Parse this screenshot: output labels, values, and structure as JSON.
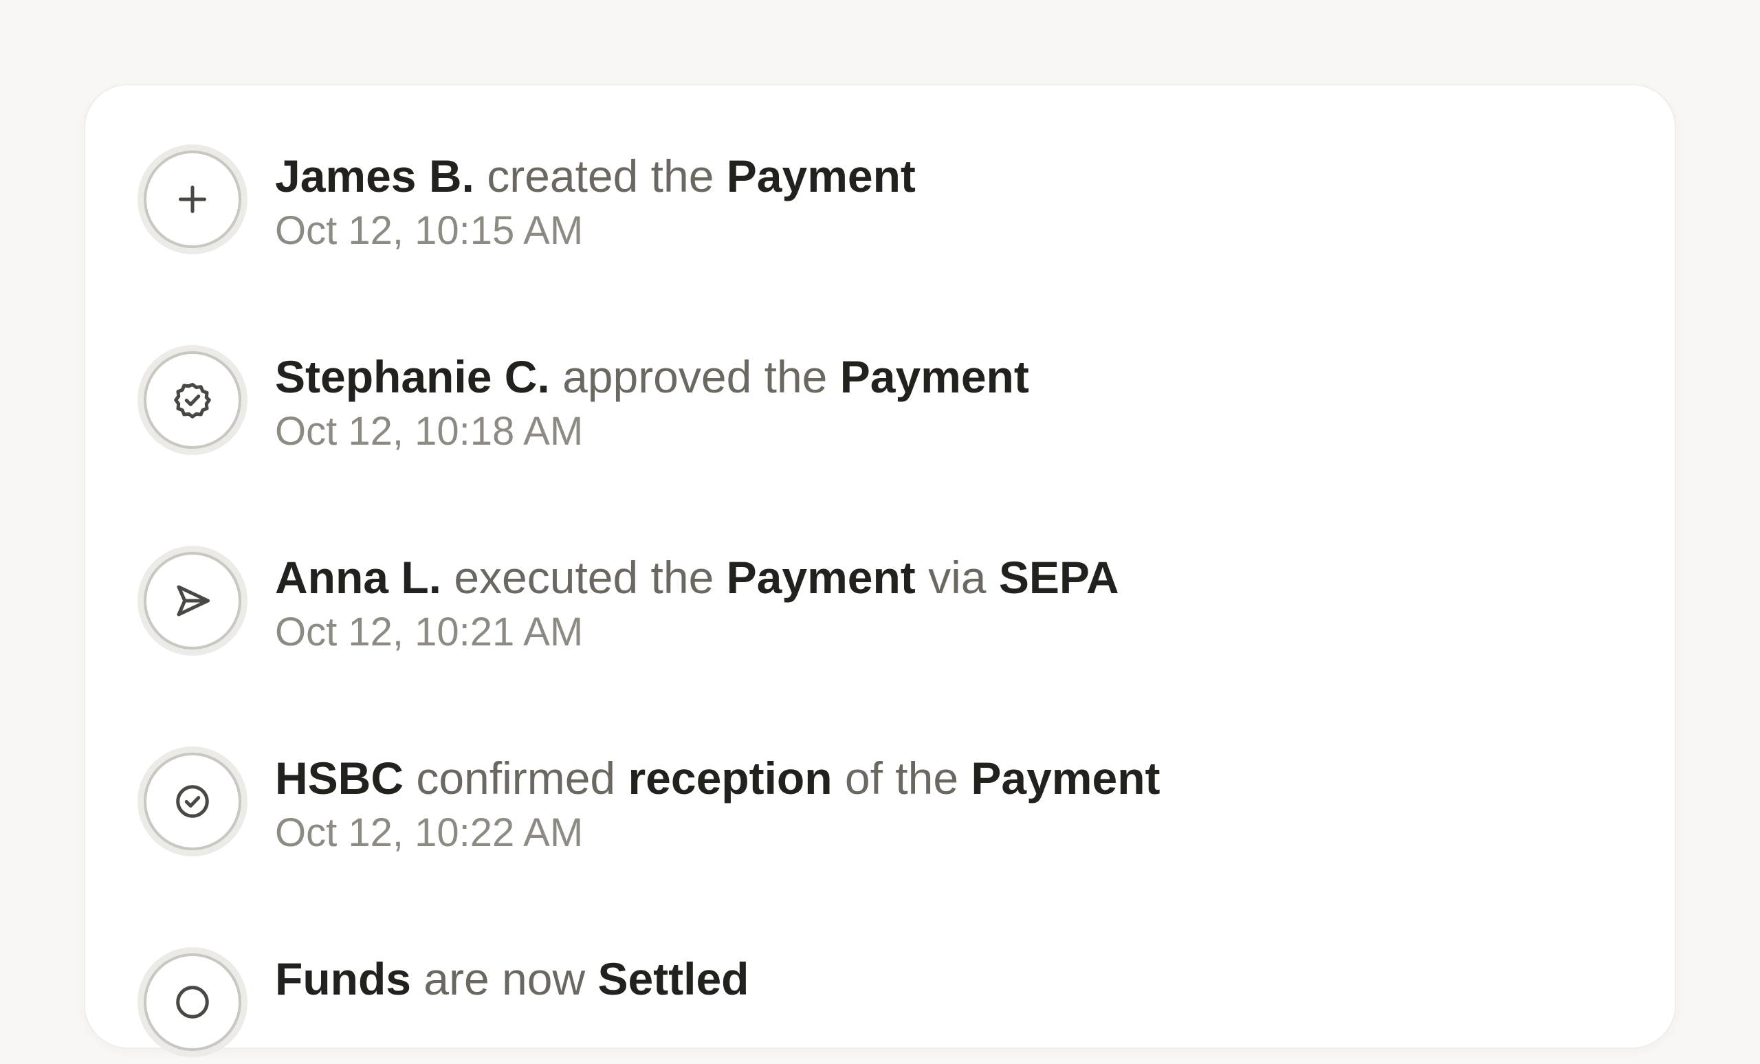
{
  "events": [
    {
      "icon": "plus-icon",
      "parts": [
        {
          "text": "James B.",
          "bold": true
        },
        {
          "text": " created the ",
          "bold": false
        },
        {
          "text": "Payment",
          "bold": true
        }
      ],
      "time": "Oct 12, 10:15 AM"
    },
    {
      "icon": "badge-check-icon",
      "parts": [
        {
          "text": "Stephanie C.",
          "bold": true
        },
        {
          "text": " approved the ",
          "bold": false
        },
        {
          "text": "Payment",
          "bold": true
        }
      ],
      "time": "Oct 12, 10:18 AM"
    },
    {
      "icon": "send-icon",
      "parts": [
        {
          "text": "Anna L.",
          "bold": true
        },
        {
          "text": " executed the ",
          "bold": false
        },
        {
          "text": "Payment",
          "bold": true
        },
        {
          "text": " via ",
          "bold": false
        },
        {
          "text": "SEPA",
          "bold": true
        }
      ],
      "time": "Oct 12, 10:21 AM"
    },
    {
      "icon": "check-circle-icon",
      "parts": [
        {
          "text": "HSBC",
          "bold": true
        },
        {
          "text": " confirmed ",
          "bold": false
        },
        {
          "text": "reception",
          "bold": true
        },
        {
          "text": " of the ",
          "bold": false
        },
        {
          "text": "Payment",
          "bold": true
        }
      ],
      "time": "Oct 12, 10:22 AM"
    },
    {
      "icon": "circle-icon",
      "parts": [
        {
          "text": "Funds",
          "bold": true
        },
        {
          "text": " are now ",
          "bold": false
        },
        {
          "text": "Settled",
          "bold": true
        }
      ],
      "time": ""
    }
  ]
}
